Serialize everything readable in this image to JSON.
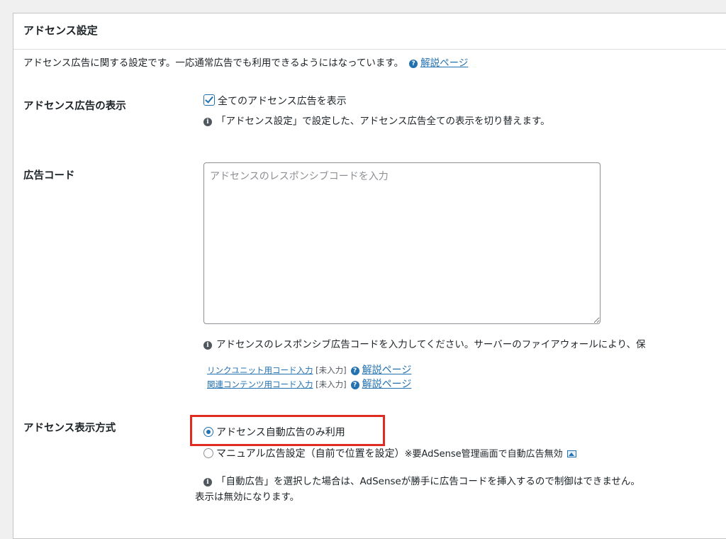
{
  "section": {
    "title": "アドセンス設定",
    "description": "アドセンス広告に関する設定です。一応通常広告でも利用できるようにはなっています。",
    "help_link": "解説ページ"
  },
  "display_setting": {
    "label": "アドセンス広告の表示",
    "checkbox_label": "全てのアドセンス広告を表示",
    "checked": true,
    "note": "「アドセンス設定」で設定した、アドセンス広告全ての表示を切り替えます。"
  },
  "ad_code": {
    "label": "広告コード",
    "placeholder": "アドセンスのレスポンシブコードを入力",
    "value": "",
    "note": "アドセンスのレスポンシブ広告コードを入力してください。サーバーのファイアウォールにより、保",
    "links": [
      {
        "text": "リンクユニット用コード入力",
        "status": "[未入力]",
        "help": "解説ページ"
      },
      {
        "text": "関連コンテンツ用コード入力",
        "status": "[未入力]",
        "help": "解説ページ"
      }
    ]
  },
  "display_method": {
    "label": "アドセンス表示方式",
    "options": [
      {
        "label": "アドセンス自動広告のみ利用",
        "selected": true
      },
      {
        "label": "マニュアル広告設定（自前で位置を設定）",
        "suffix": "※要AdSense管理画面で自動広告無効",
        "selected": false
      }
    ],
    "note_line1": "「自動広告」を選択した場合は、AdSenseが勝手に広告コードを挿入するので制御はできません。",
    "note_line2": "表示は無効になります。"
  },
  "colors": {
    "accent": "#2271b1",
    "highlight_border": "#e02b20"
  }
}
